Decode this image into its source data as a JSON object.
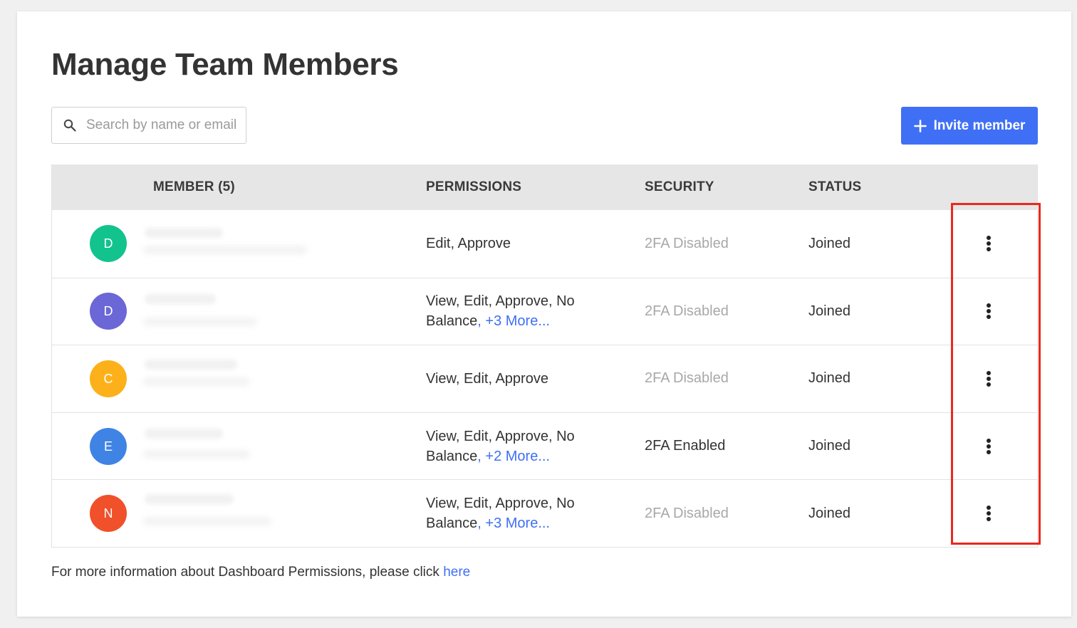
{
  "page": {
    "title": "Manage Team Members"
  },
  "search": {
    "placeholder": "Search by name or email"
  },
  "invite_button": {
    "label": "Invite member",
    "icon": "plus-icon",
    "color": "#3f6ff5"
  },
  "table": {
    "headers": {
      "member": "MEMBER (5)",
      "permissions": "PERMISSIONS",
      "security": "SECURITY",
      "status": "STATUS"
    },
    "rows": [
      {
        "initial": "D",
        "avatar_color": "#12c38d",
        "permissions": "Edit, Approve",
        "more": "",
        "security": "2FA Disabled",
        "security_enabled": false,
        "status": "Joined"
      },
      {
        "initial": "D",
        "avatar_color": "#6b67d6",
        "permissions": "View, Edit, Approve, No Balance",
        "more": ", +3 More...",
        "security": "2FA Disabled",
        "security_enabled": false,
        "status": "Joined"
      },
      {
        "initial": "C",
        "avatar_color": "#fcb11b",
        "permissions": "View, Edit, Approve",
        "more": "",
        "security": "2FA Disabled",
        "security_enabled": false,
        "status": "Joined"
      },
      {
        "initial": "E",
        "avatar_color": "#3f84e5",
        "permissions": "View, Edit, Approve, No Balance",
        "more": ", +2 More...",
        "security": "2FA Enabled",
        "security_enabled": true,
        "status": "Joined"
      },
      {
        "initial": "N",
        "avatar_color": "#f0502a",
        "permissions": "View, Edit, Approve, No Balance",
        "more": ", +3 More...",
        "security": "2FA Disabled",
        "security_enabled": false,
        "status": "Joined"
      }
    ]
  },
  "footer": {
    "text": "For more information about Dashboard Permissions, please click ",
    "link": "here"
  },
  "colors": {
    "highlight": "#e8291c",
    "link": "#3f6ff5"
  }
}
